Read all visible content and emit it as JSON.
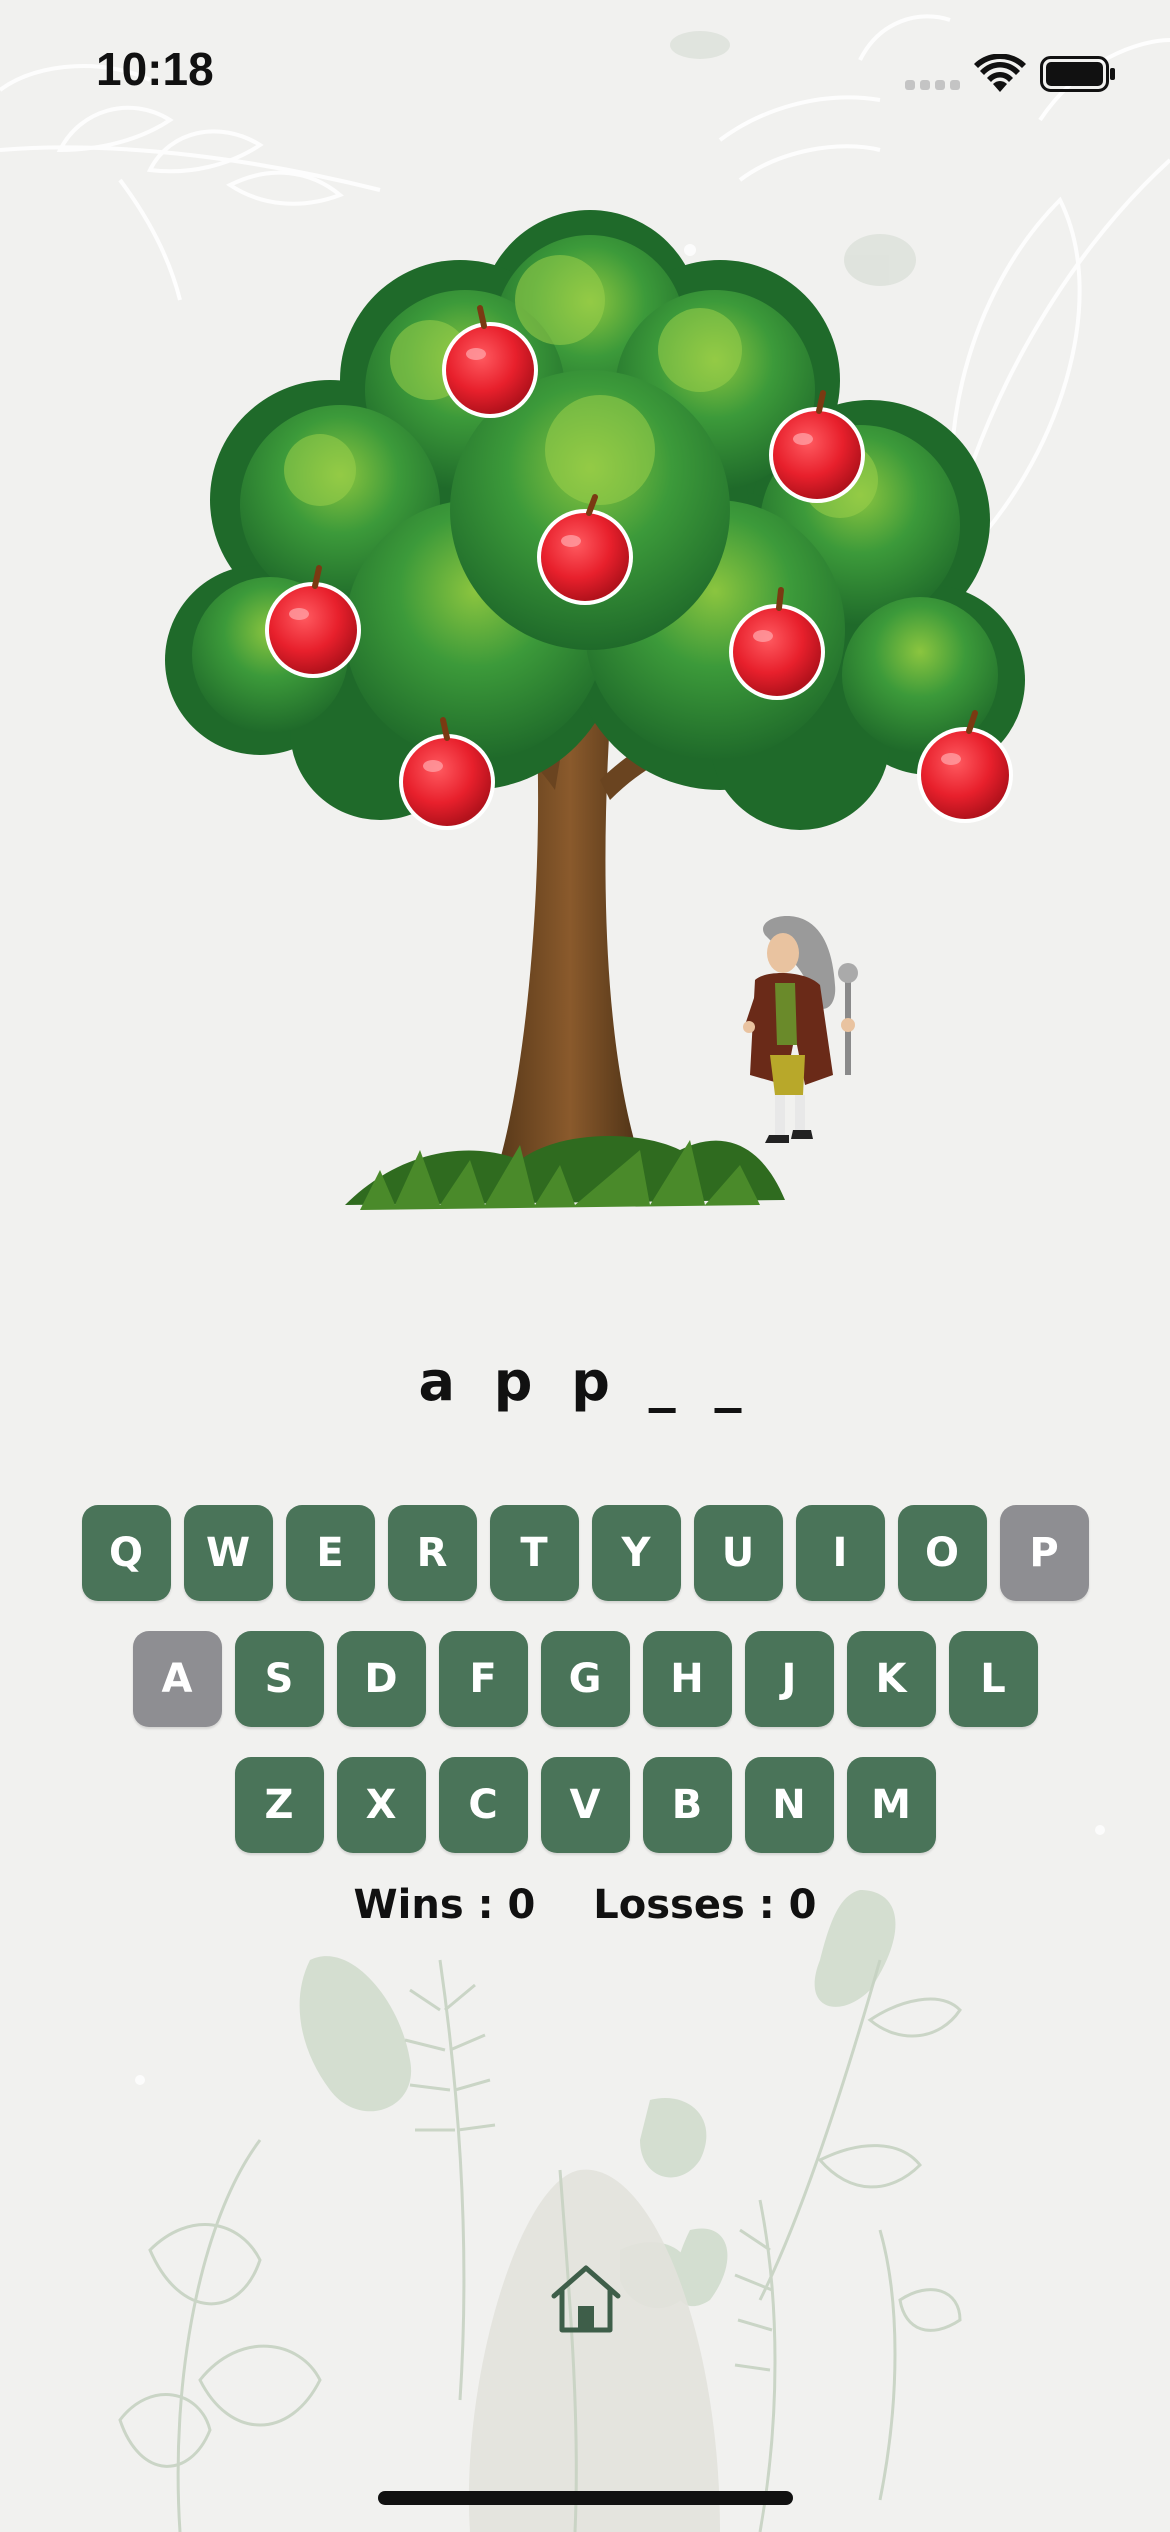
{
  "status_bar": {
    "time": "10:18"
  },
  "game": {
    "word_display": "a p p _ _",
    "apples_on_tree": 7
  },
  "keyboard": {
    "rows": [
      [
        "Q",
        "W",
        "E",
        "R",
        "T",
        "Y",
        "U",
        "I",
        "O",
        "P"
      ],
      [
        "A",
        "S",
        "D",
        "F",
        "G",
        "H",
        "J",
        "K",
        "L"
      ],
      [
        "Z",
        "X",
        "C",
        "V",
        "B",
        "N",
        "M"
      ]
    ],
    "used_letters": [
      "P",
      "A"
    ]
  },
  "score": {
    "wins_label": "Wins : 0",
    "losses_label": "Losses : 0"
  },
  "colors": {
    "key": "#4a7459",
    "key_used": "#8e8e92",
    "background": "#f1f1ef",
    "apple": "#e8202c",
    "home_icon": "#3e5e49"
  },
  "icons": {
    "home": "home-icon"
  }
}
